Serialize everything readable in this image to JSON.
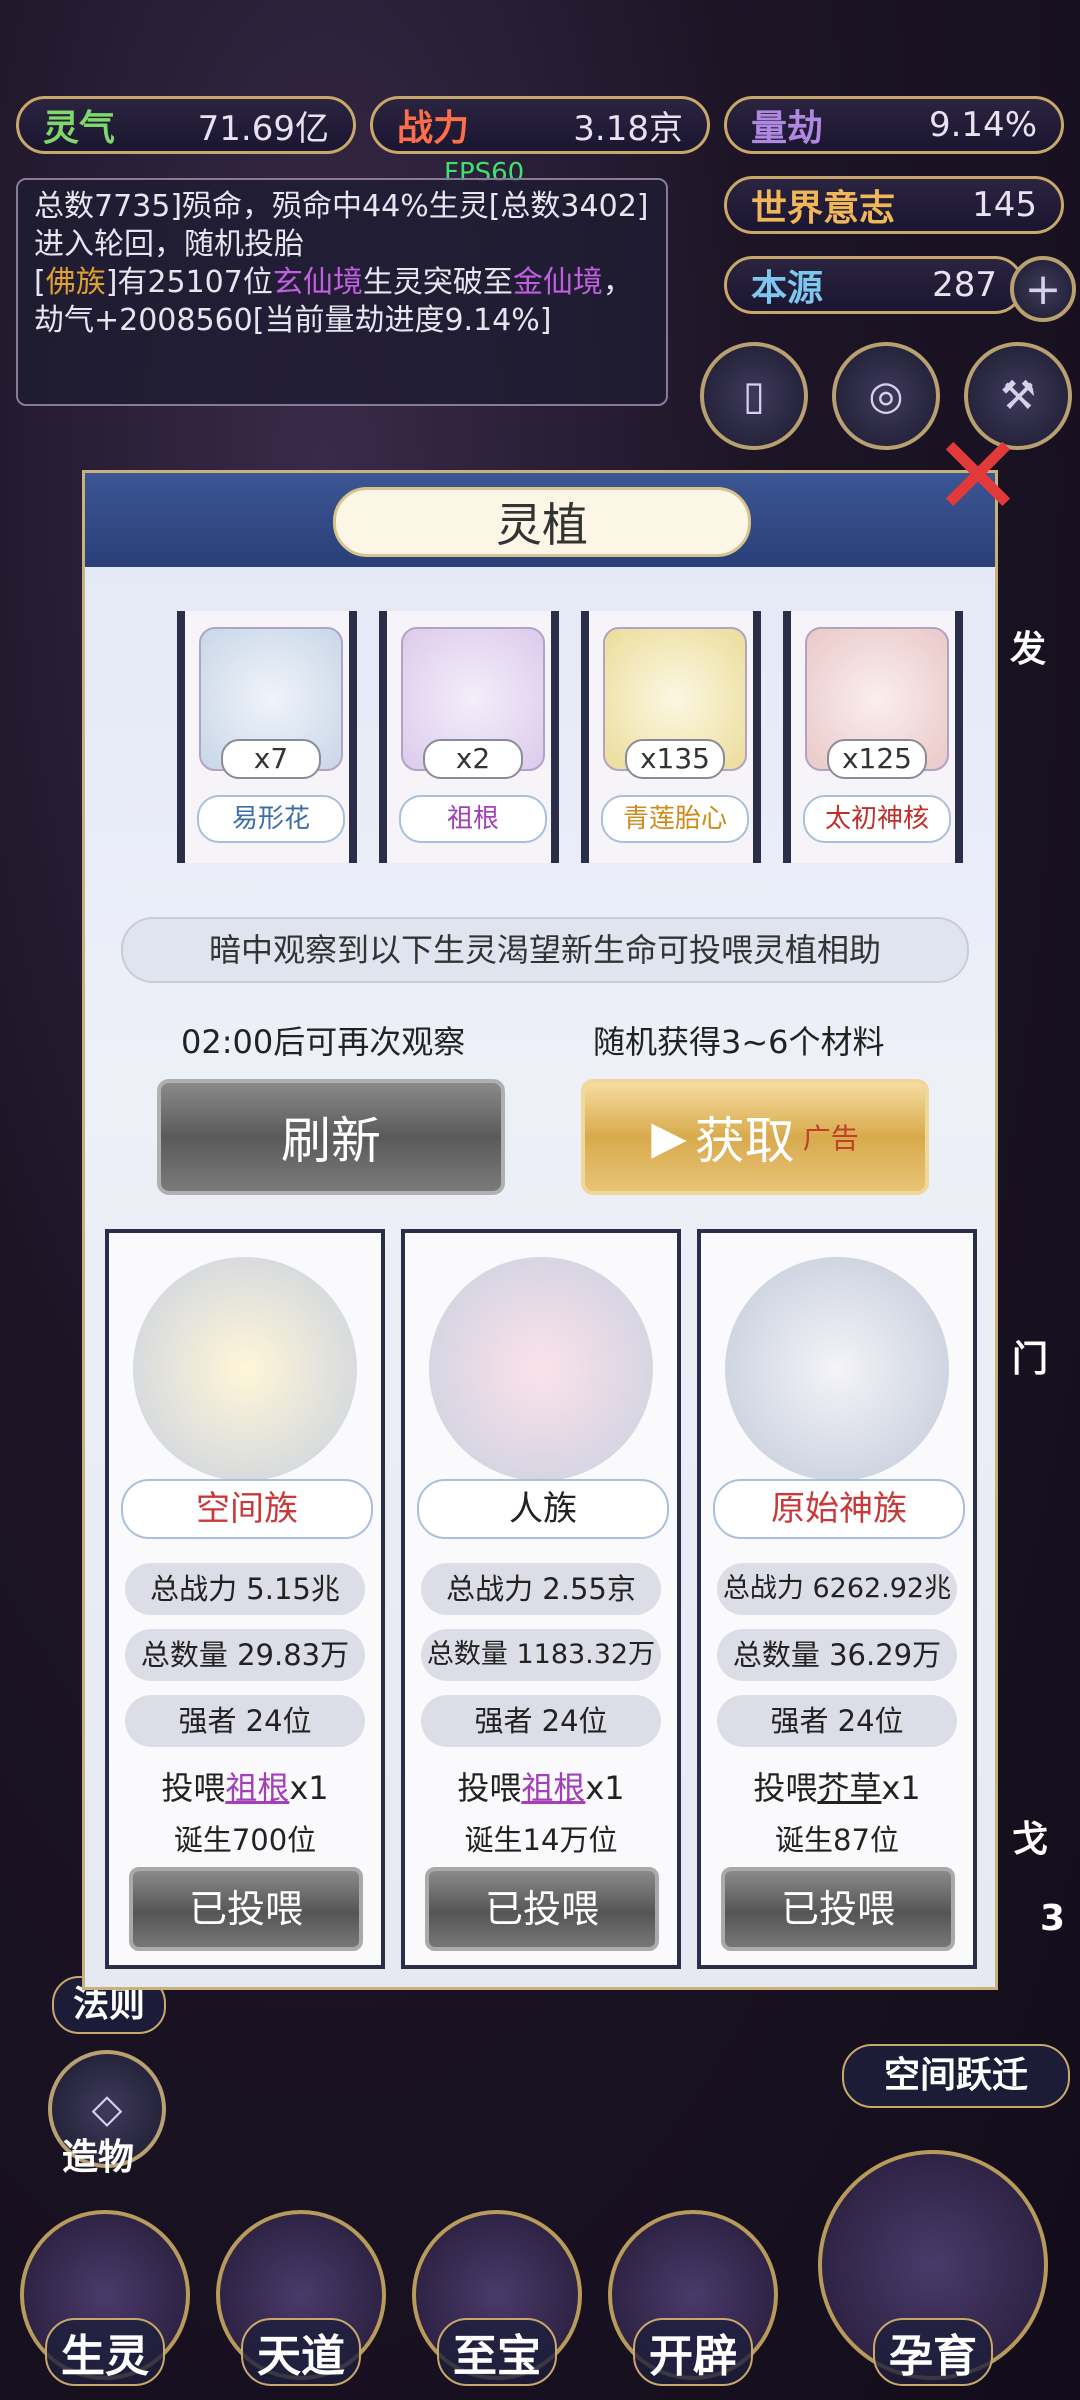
{
  "hud": {
    "stats": [
      {
        "label": "灵气",
        "value": "71.69亿",
        "color": "#7fd86b"
      },
      {
        "label": "战力",
        "value": "3.18京",
        "color": "#ff6e4a"
      },
      {
        "label": "量劫",
        "value": "9.14%",
        "color": "#b088e0"
      },
      {
        "label": "世界意志",
        "value": "145",
        "color": "#f0b65a"
      },
      {
        "label": "本源",
        "value": "287",
        "color": "#7ec8f0"
      }
    ],
    "fps": "FPS60",
    "log_line1": "总数7735]殒命，殒命中44%生灵[总数3402]进入轮回，随机投胎",
    "log_line2_a": "[",
    "log_line2_b": "佛族",
    "log_line2_c": "]有25107位",
    "log_line2_d": "玄仙境",
    "log_line2_e": "生灵突破至",
    "log_line2_f": "金仙境",
    "log_line2_g": "，劫气+2008560[当前量劫进度9.14%]",
    "plus": "+"
  },
  "modal": {
    "title": "灵植",
    "close": "✕",
    "materials": [
      {
        "qty": "x7",
        "name": "易形花",
        "color": "#3a6ea8",
        "bg": "#d6e4f2"
      },
      {
        "qty": "x2",
        "name": "祖根",
        "color": "#a33fb8",
        "bg": "#e4d6f0"
      },
      {
        "qty": "x135",
        "name": "青莲胎心",
        "color": "#d08a1a",
        "bg": "#f2ecc8"
      },
      {
        "qty": "x125",
        "name": "太初神核",
        "color": "#c0302a",
        "bg": "#f2d6d6"
      }
    ],
    "note": "暗中观察到以下生灵渴望新生命可投喂灵植相助",
    "cooldown": "02:00后可再次观察",
    "reward": "随机获得3~6个材料",
    "refresh_label": "刷新",
    "get_label": "获取",
    "ad_label": "广告",
    "races": [
      {
        "race": "空间族",
        "race_color": "#c83a3a",
        "power": "总战力 5.15兆",
        "count": "总数量 29.83万",
        "strong": "强者 24位",
        "feed_prefix": "投喂",
        "feed_item": "祖根",
        "feed_suffix": "x1",
        "born": "诞生700位",
        "done": "已投喂"
      },
      {
        "race": "人族",
        "race_color": "#222222",
        "power": "总战力 2.55京",
        "count": "总数量 1183.32万",
        "strong": "强者 24位",
        "feed_prefix": "投喂",
        "feed_item": "祖根",
        "feed_suffix": "x1",
        "born": "诞生14万位",
        "done": "已投喂"
      },
      {
        "race": "原始神族",
        "race_color": "#c83a3a",
        "power": "总战力 6262.92兆",
        "count": "总数量 36.29万",
        "strong": "强者 24位",
        "feed_prefix": "投喂",
        "feed_item": "芥草",
        "feed_suffix": "x1",
        "born": "诞生87位",
        "done": "已投喂"
      }
    ]
  },
  "side": {
    "right_label_1": "发",
    "right_label_2": "门",
    "right_label_3": "戈",
    "right_badge": "3",
    "space_jump": "空间跃迁",
    "law": "法则",
    "create": "造物"
  },
  "nav": [
    {
      "label": "生灵"
    },
    {
      "label": "天道"
    },
    {
      "label": "至宝"
    },
    {
      "label": "开辟"
    },
    {
      "label": "孕育"
    }
  ]
}
